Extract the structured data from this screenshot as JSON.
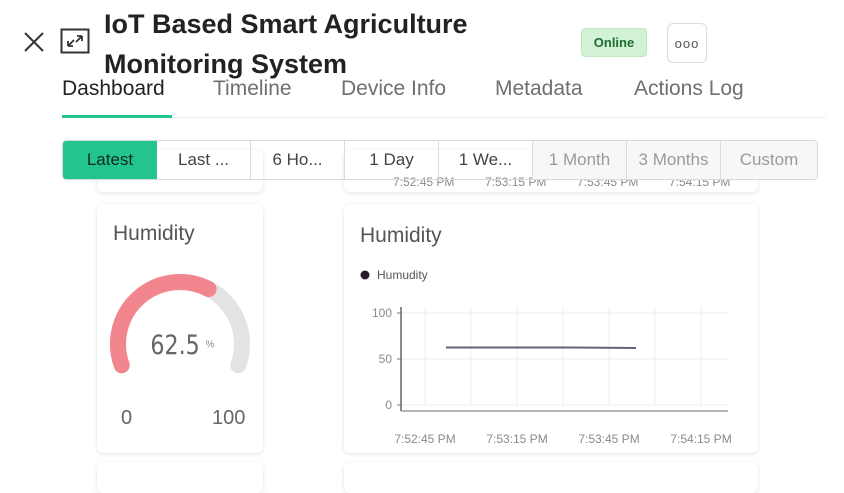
{
  "header": {
    "title_line1": "IoT Based Smart Agriculture",
    "title_line2": "Monitoring System",
    "status": "Online",
    "more_glyph": "ooo"
  },
  "tabs": [
    {
      "label": "Dashboard",
      "active": true
    },
    {
      "label": "Timeline"
    },
    {
      "label": "Device Info"
    },
    {
      "label": "Metadata"
    },
    {
      "label": "Actions Log"
    }
  ],
  "time_ranges": [
    "Latest",
    "Last ...",
    "6 Ho...",
    "1 Day",
    "1 We...",
    "1 Month",
    "3 Months",
    "Custom"
  ],
  "gauge": {
    "title": "Humidity",
    "value": "62.5",
    "unit": "%",
    "min": "0",
    "max": "100",
    "fraction": 0.625,
    "color": "#f2868f"
  },
  "chart_card": {
    "title": "Humidity",
    "legend": "Humudity"
  },
  "chart_data": {
    "type": "line",
    "series": [
      {
        "name": "Humudity",
        "values": [
          62.5,
          62.5,
          62.5,
          62
        ]
      }
    ],
    "x_ticks": [
      "7:52:45 PM",
      "7:53:15 PM",
      "7:53:45 PM",
      "7:54:15 PM"
    ],
    "y_ticks": [
      "100",
      "50",
      "0"
    ],
    "ylim": [
      0,
      100
    ],
    "grid": true,
    "line_color": "#6b5f72",
    "legend_color": "#2b1b2e"
  },
  "top_partial_ticks": [
    "7:52:45 PM",
    "7:53:15 PM",
    "7:53:45 PM",
    "7:54:15 PM"
  ],
  "colors": {
    "accent": "#23c48e",
    "online_bg": "#d2f2d6"
  }
}
